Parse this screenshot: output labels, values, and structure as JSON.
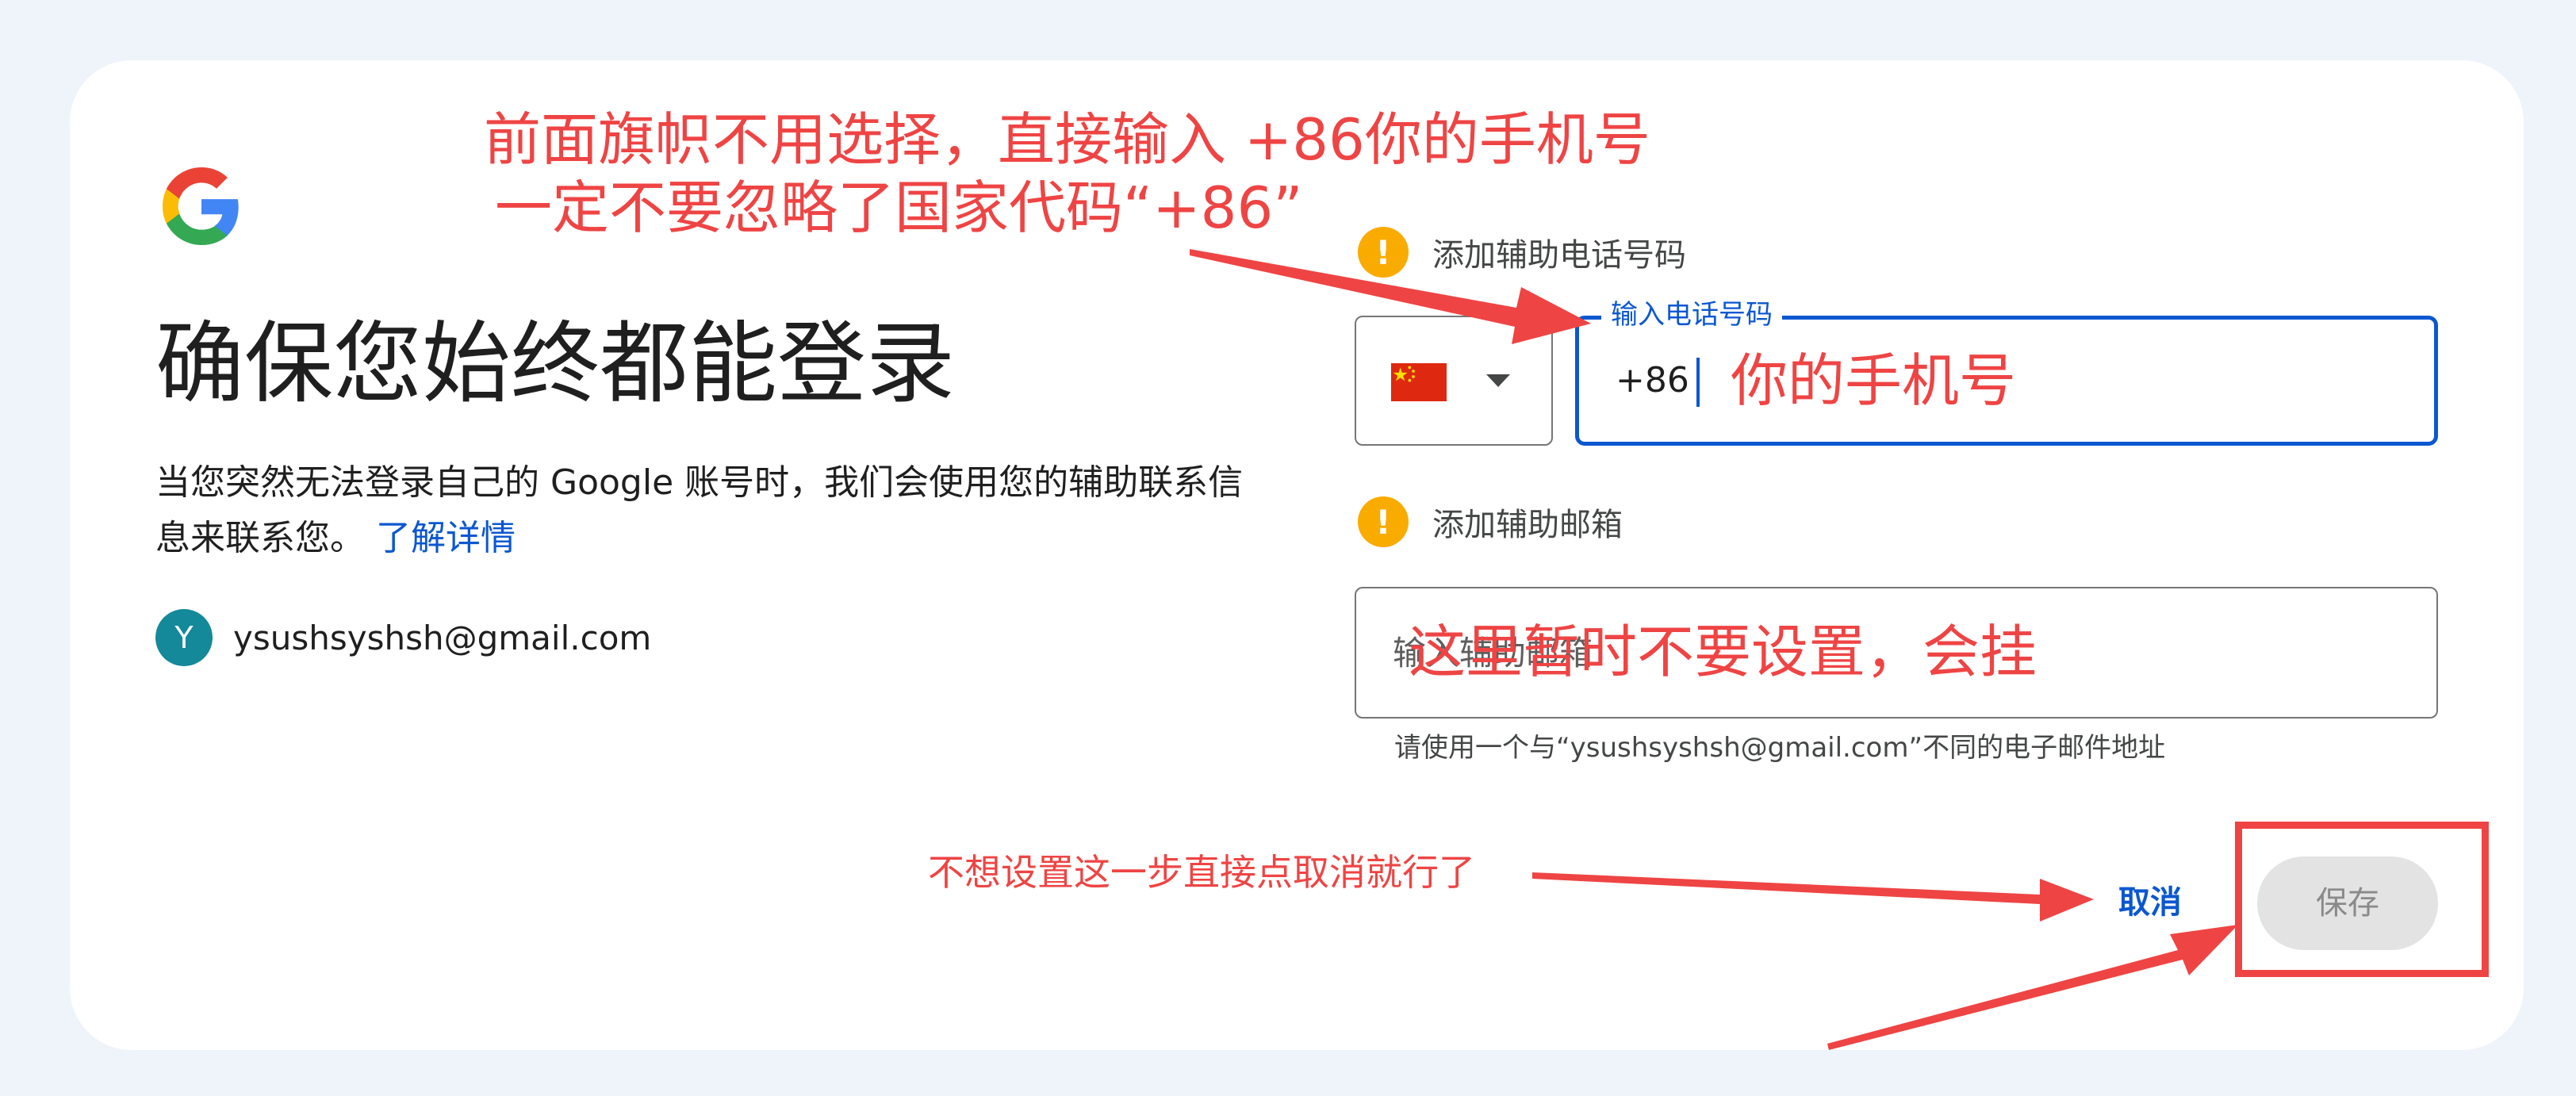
{
  "page": {
    "title": "确保您始终都能登录",
    "description": "当您突然无法登录自己的 Google 账号时，我们会使用您的辅助联系信息来联系您。",
    "learn_more": "了解详情"
  },
  "account": {
    "avatar_letter": "Y",
    "email": "ysushsyshsh@gmail.com"
  },
  "phone": {
    "warning_label": "添加辅助电话号码",
    "country_flag": "china-flag",
    "field_label": "输入电话号码",
    "prefix": "+86"
  },
  "recovery_email": {
    "warning_label": "添加辅助邮箱",
    "placeholder": "输入辅助邮箱",
    "helper": "请使用一个与“ysushsyshsh@gmail.com”不同的电子邮件地址"
  },
  "actions": {
    "cancel": "取消",
    "save": "保存"
  },
  "annotations": {
    "line1": "前面旗帜不用选择，直接输入   +86你的手机号",
    "line2": "一定不要忽略了国家代码“+86”",
    "phone_hint": "你的手机号",
    "email_hint": "这里暂时不要设置，会挂",
    "cancel_hint": "不想设置这一步直接点取消就行了"
  },
  "colors": {
    "background": "#eff3fa",
    "accent": "#0b57d0",
    "warning": "#f9ab00",
    "annotation": "#ef4444",
    "avatar": "#13899a"
  }
}
